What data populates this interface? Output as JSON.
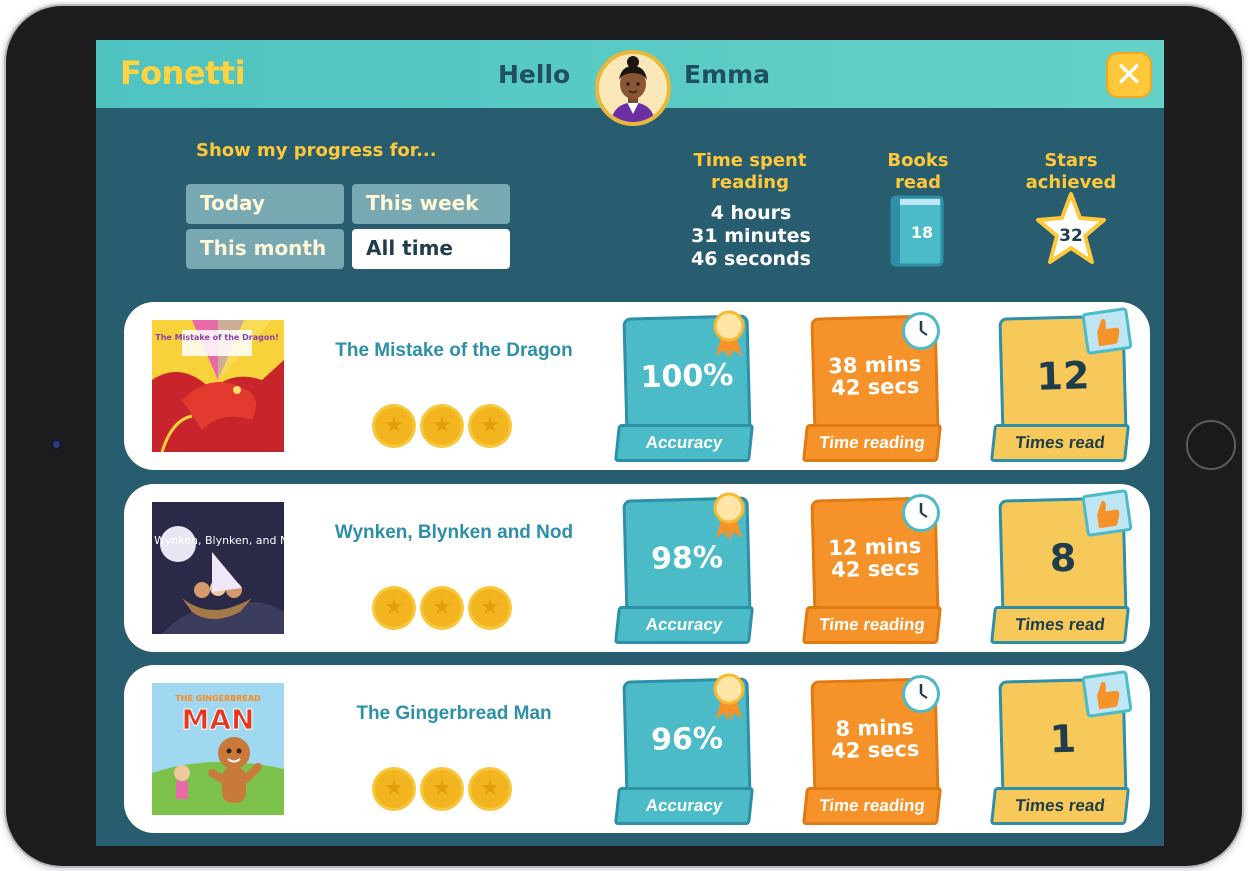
{
  "header": {
    "app_name": "Fonetti",
    "greeting": "Hello",
    "user_name": "Emma",
    "close_symbol": "✕"
  },
  "progress_filter": {
    "label": "Show my progress for...",
    "options": [
      "Today",
      "This week",
      "This month",
      "All time"
    ],
    "selected": "All time"
  },
  "stats": {
    "time_title": "Time spent reading",
    "time_hours": "4 hours",
    "time_minutes": "31 minutes",
    "time_seconds": "46 seconds",
    "books_title": "Books read",
    "books_count": "18",
    "stars_title": "Stars achieved",
    "stars_count": "32"
  },
  "labels": {
    "accuracy": "Accuracy",
    "time_reading": "Time reading",
    "times_read": "Times read"
  },
  "books": [
    {
      "title": "The Mistake of the Dragon",
      "stars": 3,
      "accuracy": "100%",
      "time_line1": "38 mins",
      "time_line2": "42 secs",
      "times_read": "12",
      "cover_text": "The Mistake of the Dragon!"
    },
    {
      "title": "Wynken, Blynken and Nod",
      "stars": 3,
      "accuracy": "98%",
      "time_line1": "12 mins",
      "time_line2": "42 secs",
      "times_read": "8",
      "cover_text": "Wynken, Blynken, and Nod"
    },
    {
      "title": "The Gingerbread Man",
      "stars": 3,
      "accuracy": "96%",
      "time_line1": "8 mins",
      "time_line2": "42 secs",
      "times_read": "1",
      "cover_text_top": "THE GINGERBREAD",
      "cover_text_main": "MAN"
    }
  ],
  "colors": {
    "screen_bg": "#275d6f",
    "header_bg": "#4fc3c0",
    "accent_yellow": "#ffc83a",
    "accuracy_teal": "#4bbcc7",
    "time_orange": "#f5932a",
    "read_yellow": "#f7c95a"
  }
}
